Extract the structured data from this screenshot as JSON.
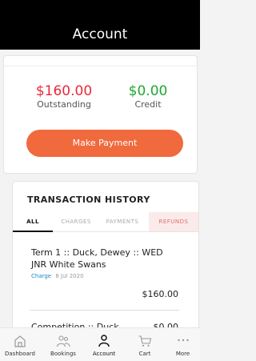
{
  "header": {
    "title": "Account"
  },
  "balance": {
    "outstanding_amount": "$160.00",
    "outstanding_label": "Outstanding",
    "credit_amount": "$0.00",
    "credit_label": "Credit",
    "pay_button": "Make Payment",
    "colors": {
      "outstanding": "#e8293b",
      "credit": "#1ea832",
      "button": "#f06a3d"
    }
  },
  "transactions": {
    "title": "TRANSACTION HISTORY",
    "tabs": [
      {
        "label": "ALL",
        "active": true
      },
      {
        "label": "CHARGES",
        "active": false
      },
      {
        "label": "PAYMENTS",
        "active": false
      },
      {
        "label": "REFUNDS",
        "active": false
      }
    ],
    "items": [
      {
        "name": "Term 1 :: Duck, Dewey :: WED JNR White Swans",
        "type": "Charge",
        "date": "8 Jul 2020",
        "amount": "$160.00"
      },
      {
        "name": "Competition :: Duck",
        "type": "",
        "date": "",
        "amount": "$0.00"
      }
    ]
  },
  "bottom_nav": [
    {
      "label": "Dashboard",
      "icon": "home-icon"
    },
    {
      "label": "Bookings",
      "icon": "people-icon"
    },
    {
      "label": "Account",
      "icon": "person-icon",
      "active": true
    },
    {
      "label": "Cart",
      "icon": "cart-icon"
    },
    {
      "label": "More",
      "icon": "more-icon"
    }
  ]
}
